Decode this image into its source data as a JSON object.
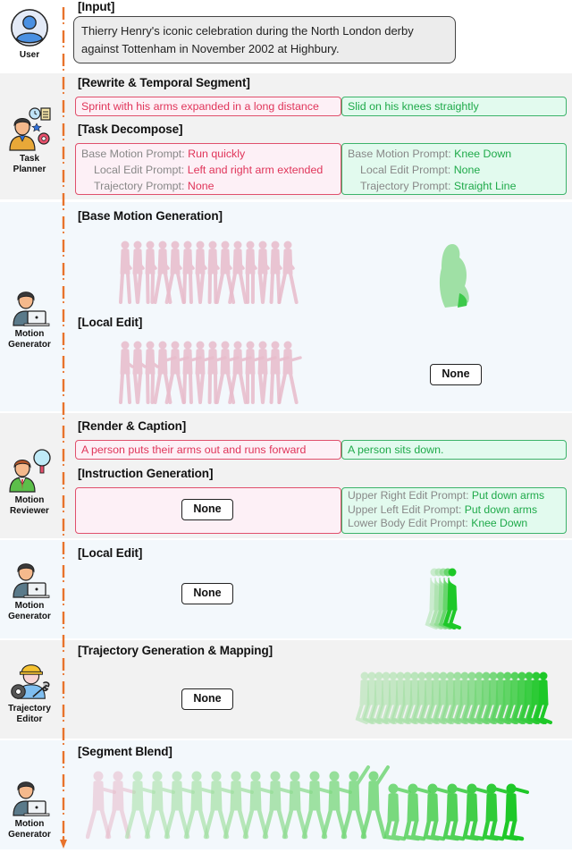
{
  "colors": {
    "timeline": "#e8732c",
    "red_text": "#e0355a",
    "red_border": "#e0506c",
    "red_fill": "#fdf0f6",
    "green_text": "#1faa4a",
    "green_border": "#3cb36a",
    "green_fill": "#e2faee",
    "pink_figure": "#e8bccb",
    "green_figure": "#5fd06a"
  },
  "agents": {
    "user": {
      "label": "User",
      "icon": "user-icon"
    },
    "task_planner": {
      "label_1": "Task",
      "label_2": "Planner",
      "icon": "task-planner-icon"
    },
    "motion_generator_1": {
      "label_1": "Motion",
      "label_2": "Generator",
      "icon": "motion-generator-icon"
    },
    "motion_reviewer": {
      "label_1": "Motion",
      "label_2": "Reviewer",
      "icon": "motion-reviewer-icon"
    },
    "motion_generator_2": {
      "label_1": "Motion",
      "label_2": "Generator",
      "icon": "motion-generator-icon"
    },
    "trajectory_editor": {
      "label_1": "Trajectory",
      "label_2": "Editor",
      "icon": "trajectory-editor-icon"
    },
    "motion_generator_3": {
      "label_1": "Motion",
      "label_2": "Generator",
      "icon": "motion-generator-icon"
    }
  },
  "input": {
    "heading": "[Input]",
    "text": "Thierry Henry's iconic celebration during the North London derby against Tottenham in November 2002 at Highbury."
  },
  "rewrite": {
    "heading": "[Rewrite & Temporal Segment]",
    "segment_1": "Sprint with his arms expanded in a long distance",
    "segment_2": "Slid on his knees straightly"
  },
  "decompose": {
    "heading": "[Task Decompose]",
    "segment_1": [
      {
        "key": "Base Motion Prompt: ",
        "value": "Run quickly"
      },
      {
        "key": "Local Edit Prompt: ",
        "value": "Left and right arm extended"
      },
      {
        "key": "Trajectory Prompt: ",
        "value": "None"
      }
    ],
    "segment_2": [
      {
        "key": "Base Motion Prompt: ",
        "value": "Knee Down"
      },
      {
        "key": "Local Edit Prompt: ",
        "value": "None"
      },
      {
        "key": "Trajectory Prompt: ",
        "value": "Straight Line"
      }
    ]
  },
  "base_motion": {
    "heading": "[Base Motion Generation]"
  },
  "local_edit_1": {
    "heading": "[Local Edit]",
    "segment_2_result": "None"
  },
  "render": {
    "heading": "[Render & Caption]",
    "segment_1": "A person puts their arms out and runs forward",
    "segment_2": "A person sits down."
  },
  "instruction": {
    "heading": "[Instruction Generation]",
    "segment_1_result": "None",
    "segment_2": [
      {
        "key": "Upper Right Edit Prompt: ",
        "value": "Put down arms"
      },
      {
        "key": "Upper Left Edit Prompt: ",
        "value": "Put down arms"
      },
      {
        "key": "Lower Body Edit Prompt: ",
        "value": "Knee Down"
      }
    ]
  },
  "local_edit_2": {
    "heading": "[Local Edit]",
    "segment_1_result": "None"
  },
  "trajectory": {
    "heading": "[Trajectory Generation & Mapping]",
    "segment_1_result": "None"
  },
  "blend": {
    "heading": "[Segment Blend]"
  }
}
